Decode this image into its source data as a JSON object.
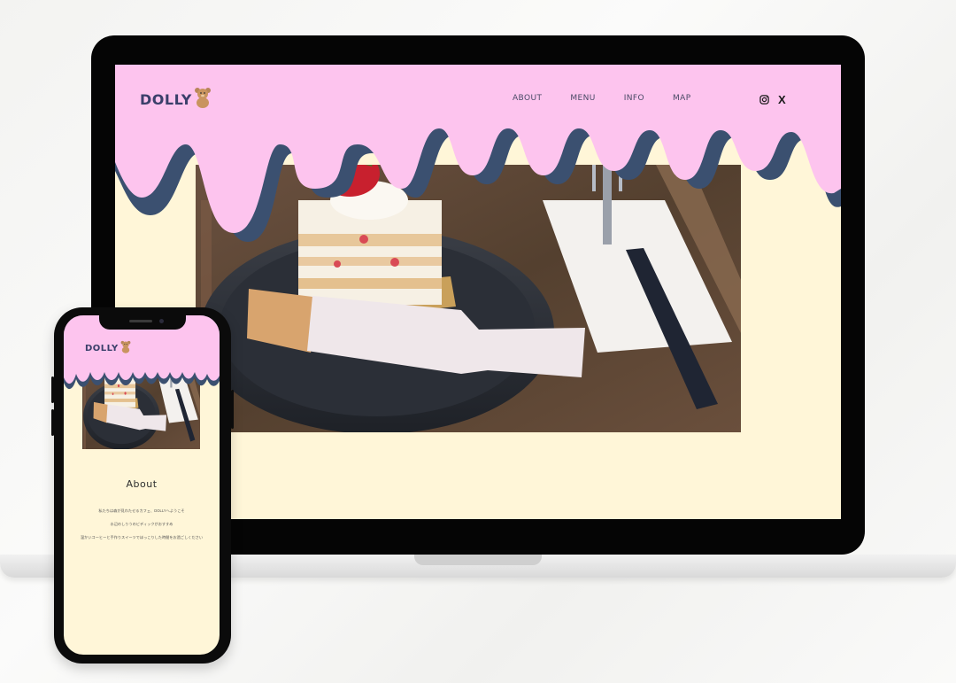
{
  "site": {
    "logo_text": "DOLLY",
    "logo_icon": "teddy-bear-icon",
    "nav": [
      {
        "label": "ABOUT"
      },
      {
        "label": "MENU"
      },
      {
        "label": "INFO"
      },
      {
        "label": "MAP"
      }
    ],
    "social": [
      {
        "icon": "instagram-icon"
      },
      {
        "icon": "x-icon",
        "glyph": "X"
      }
    ]
  },
  "about": {
    "heading": "About",
    "lines": [
      "私たちは森が見わたせるカフェ、DOLLYへようこそ",
      "水辺のしりうのビディックがおすすめ",
      "温かいコーヒーと手作りスイーツでほっこりした時間をお過ごしください"
    ]
  },
  "colors": {
    "header_pink": "#fdc4ee",
    "drip_shadow": "#3b5070",
    "page_background": "#fff6d8",
    "logo_navy": "#3a3f6a"
  }
}
